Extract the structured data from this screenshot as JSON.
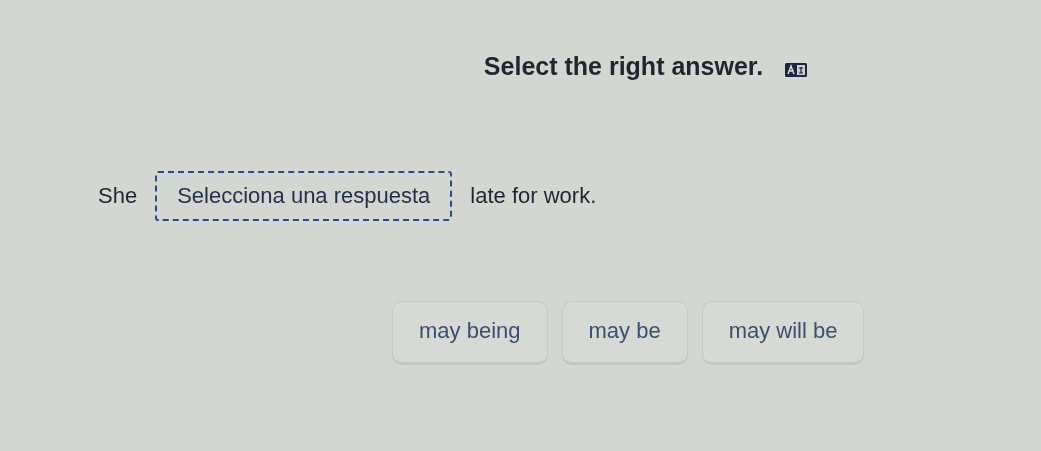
{
  "prompt": "Select the right answer.",
  "sentence": {
    "before": "She",
    "blank": {
      "placeholder": "Selecciona una respuesta"
    },
    "after": "late for work."
  },
  "options": [
    {
      "label": "may being",
      "selected": false
    },
    {
      "label": "may be",
      "selected": false
    },
    {
      "label": "may will be",
      "selected": false
    }
  ]
}
